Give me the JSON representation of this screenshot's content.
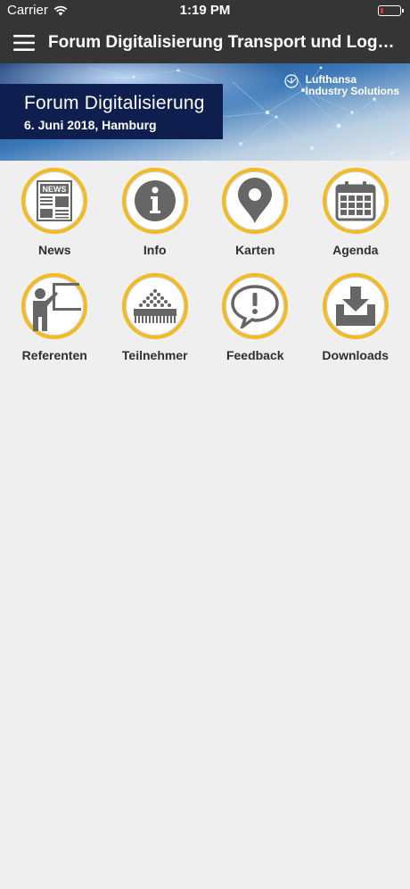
{
  "statusbar": {
    "carrier": "Carrier",
    "time": "1:19 PM",
    "battery_level": 0.15
  },
  "navbar": {
    "title": "Forum Digitalisierung Transport und Logis..."
  },
  "banner": {
    "title": "Forum Digitalisierung",
    "subtitle": "6. Juni 2018, Hamburg",
    "logo_line1": "Lufthansa",
    "logo_line2": "Industry Solutions"
  },
  "tiles": [
    {
      "label": "News",
      "icon": "newspaper-icon",
      "icon_text": "NEWS"
    },
    {
      "label": "Info",
      "icon": "info-icon"
    },
    {
      "label": "Karten",
      "icon": "map-pin-icon"
    },
    {
      "label": "Agenda",
      "icon": "calendar-icon"
    },
    {
      "label": "Referenten",
      "icon": "presenter-icon"
    },
    {
      "label": "Teilnehmer",
      "icon": "audience-icon"
    },
    {
      "label": "Feedback",
      "icon": "feedback-bubble-icon"
    },
    {
      "label": "Downloads",
      "icon": "download-tray-icon"
    }
  ],
  "colors": {
    "bar": "#353535",
    "ring": "#f2bb22",
    "icon": "#666666",
    "banner_box": "#0e1f4f"
  }
}
